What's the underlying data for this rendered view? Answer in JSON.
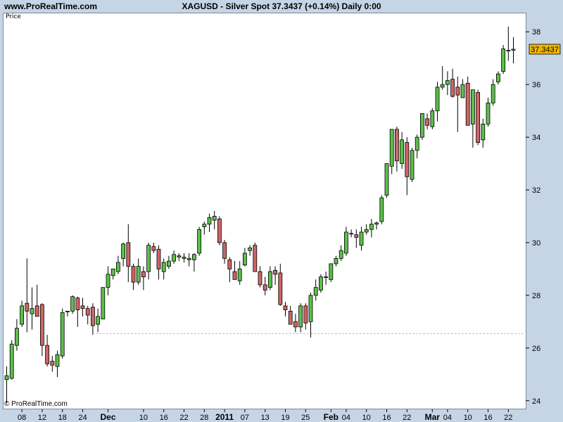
{
  "header": {
    "site": "www.ProRealTime.com",
    "title": "XAGUSD - Silver Spot    37.3437 (+0.14%)    Daily  0:00"
  },
  "panel": {
    "label": "Price"
  },
  "footer": {
    "copyright": "© ProRealTime.com"
  },
  "colors": {
    "up": "#5cbf4a",
    "down": "#cc6666",
    "background": "#c6d5e6",
    "last_price_box": "#f2b600"
  },
  "chart_data": {
    "type": "candlestick",
    "instrument": "XAGUSD - Silver Spot",
    "last_price": "37.3437",
    "change": "+0.14%",
    "timeframe": "Daily",
    "ylim": [
      23.7,
      38.7
    ],
    "yticks": [
      24,
      26,
      28,
      30,
      32,
      34,
      36,
      38
    ],
    "support_level": 26.55,
    "x_ticks": [
      {
        "label": "08",
        "i": 3,
        "bold": false
      },
      {
        "label": "12",
        "i": 7,
        "bold": false
      },
      {
        "label": "18",
        "i": 11,
        "bold": false
      },
      {
        "label": "24",
        "i": 15,
        "bold": false
      },
      {
        "label": "Dec",
        "i": 20,
        "bold": true
      },
      {
        "label": "10",
        "i": 27,
        "bold": false
      },
      {
        "label": "16",
        "i": 31,
        "bold": false
      },
      {
        "label": "22",
        "i": 35,
        "bold": false
      },
      {
        "label": "28",
        "i": 39,
        "bold": false
      },
      {
        "label": "2011",
        "i": 43,
        "bold": true
      },
      {
        "label": "07",
        "i": 47,
        "bold": false
      },
      {
        "label": "13",
        "i": 51,
        "bold": false
      },
      {
        "label": "19",
        "i": 55,
        "bold": false
      },
      {
        "label": "25",
        "i": 59,
        "bold": false
      },
      {
        "label": "Feb",
        "i": 64,
        "bold": true
      },
      {
        "label": "04",
        "i": 67,
        "bold": false
      },
      {
        "label": "10",
        "i": 71,
        "bold": false
      },
      {
        "label": "16",
        "i": 75,
        "bold": false
      },
      {
        "label": "22",
        "i": 79,
        "bold": false
      },
      {
        "label": "Mar",
        "i": 84,
        "bold": true
      },
      {
        "label": "04",
        "i": 87,
        "bold": false
      },
      {
        "label": "10",
        "i": 91,
        "bold": false
      },
      {
        "label": "16",
        "i": 95,
        "bold": false
      },
      {
        "label": "22",
        "i": 99,
        "bold": false
      }
    ],
    "candles": [
      [
        24.8,
        25.3,
        23.9,
        24.95
      ],
      [
        24.85,
        26.3,
        24.8,
        26.15
      ],
      [
        26.1,
        27.1,
        25.9,
        26.75
      ],
      [
        26.9,
        27.8,
        26.8,
        27.6
      ],
      [
        27.7,
        29.4,
        26.6,
        27.4
      ],
      [
        27.3,
        28.3,
        26.7,
        27.5
      ],
      [
        27.6,
        28.4,
        27.4,
        27.2
      ],
      [
        27.65,
        27.7,
        25.7,
        26.1
      ],
      [
        26.1,
        26.5,
        25.3,
        25.4
      ],
      [
        25.5,
        25.7,
        25.1,
        25.35
      ],
      [
        25.3,
        25.9,
        24.9,
        25.75
      ],
      [
        25.7,
        27.5,
        25.6,
        27.35
      ],
      [
        27.4,
        27.4,
        27.2,
        27.4
      ],
      [
        27.4,
        28.0,
        27.3,
        27.95
      ],
      [
        27.9,
        27.95,
        26.8,
        27.45
      ],
      [
        27.6,
        27.9,
        27.2,
        27.5
      ],
      [
        27.5,
        27.6,
        26.9,
        27.25
      ],
      [
        27.55,
        27.7,
        26.5,
        26.85
      ],
      [
        26.9,
        27.5,
        26.6,
        27.2
      ],
      [
        27.1,
        28.3,
        27.1,
        28.3
      ],
      [
        28.3,
        29.1,
        28.0,
        28.8
      ],
      [
        28.75,
        29.0,
        28.6,
        29.0
      ],
      [
        28.9,
        29.5,
        28.8,
        29.25
      ],
      [
        29.4,
        30.0,
        29.1,
        29.95
      ],
      [
        30.0,
        30.7,
        28.5,
        29.1
      ],
      [
        29.1,
        29.2,
        28.2,
        28.5
      ],
      [
        28.5,
        29.4,
        28.4,
        29.1
      ],
      [
        28.9,
        29.1,
        28.2,
        28.7
      ],
      [
        28.9,
        30.0,
        28.6,
        29.9
      ],
      [
        29.85,
        30.0,
        29.6,
        29.7
      ],
      [
        29.75,
        29.9,
        28.6,
        29.0
      ],
      [
        28.9,
        29.4,
        28.6,
        29.25
      ],
      [
        29.1,
        29.5,
        29.0,
        29.3
      ],
      [
        29.3,
        29.7,
        29.2,
        29.55
      ],
      [
        29.45,
        29.6,
        29.3,
        29.5
      ],
      [
        29.45,
        29.6,
        29.25,
        29.4
      ],
      [
        29.35,
        29.6,
        29.1,
        29.4
      ],
      [
        29.35,
        29.6,
        28.9,
        29.55
      ],
      [
        29.6,
        30.6,
        29.5,
        30.5
      ],
      [
        30.6,
        30.8,
        30.3,
        30.7
      ],
      [
        30.7,
        31.1,
        30.4,
        30.95
      ],
      [
        30.85,
        31.2,
        30.5,
        31.0
      ],
      [
        30.9,
        31.0,
        29.9,
        30.0
      ],
      [
        30.0,
        30.1,
        29.2,
        29.4
      ],
      [
        29.35,
        29.45,
        28.5,
        29.0
      ],
      [
        28.9,
        29.3,
        28.6,
        28.6
      ],
      [
        28.55,
        29.3,
        28.4,
        29.0
      ],
      [
        29.15,
        29.8,
        29.1,
        29.6
      ],
      [
        29.7,
        29.9,
        29.5,
        29.8
      ],
      [
        29.9,
        30.0,
        28.9,
        28.9
      ],
      [
        28.9,
        29.1,
        28.3,
        28.4
      ],
      [
        28.4,
        28.7,
        28.0,
        28.2
      ],
      [
        28.3,
        29.1,
        28.2,
        28.9
      ],
      [
        28.95,
        29.1,
        28.4,
        28.8
      ],
      [
        28.85,
        29.2,
        27.6,
        27.65
      ],
      [
        27.6,
        27.75,
        27.2,
        27.45
      ],
      [
        27.4,
        27.6,
        26.9,
        26.9
      ],
      [
        27.0,
        27.3,
        26.6,
        26.8
      ],
      [
        26.8,
        27.7,
        26.6,
        27.6
      ],
      [
        27.6,
        27.7,
        26.7,
        26.95
      ],
      [
        27.0,
        28.1,
        26.4,
        28.0
      ],
      [
        28.0,
        28.6,
        27.8,
        28.3
      ],
      [
        28.2,
        28.8,
        28.1,
        28.7
      ],
      [
        28.7,
        28.9,
        28.4,
        28.7
      ],
      [
        28.6,
        29.2,
        28.5,
        29.2
      ],
      [
        29.2,
        29.5,
        29.1,
        29.4
      ],
      [
        29.4,
        29.9,
        29.3,
        29.7
      ],
      [
        29.6,
        30.6,
        29.5,
        30.4
      ],
      [
        30.35,
        30.5,
        30.2,
        30.35
      ],
      [
        30.3,
        30.5,
        29.8,
        30.2
      ],
      [
        29.9,
        30.6,
        29.7,
        30.4
      ],
      [
        30.4,
        30.7,
        30.3,
        30.5
      ],
      [
        30.5,
        30.9,
        30.2,
        30.7
      ],
      [
        30.7,
        30.8,
        30.5,
        30.75
      ],
      [
        30.8,
        31.8,
        30.7,
        31.7
      ],
      [
        31.8,
        33.0,
        31.7,
        33.0
      ],
      [
        32.9,
        34.3,
        32.6,
        34.3
      ],
      [
        34.3,
        34.4,
        32.7,
        33.1
      ],
      [
        33.0,
        34.2,
        32.8,
        33.9
      ],
      [
        33.8,
        34.0,
        31.8,
        32.5
      ],
      [
        32.4,
        33.6,
        32.3,
        33.5
      ],
      [
        33.5,
        34.1,
        33.2,
        34.0
      ],
      [
        34.0,
        34.9,
        33.9,
        34.9
      ],
      [
        34.7,
        34.9,
        34.3,
        34.45
      ],
      [
        34.4,
        35.1,
        34.3,
        35.0
      ],
      [
        35.0,
        36.1,
        34.6,
        35.9
      ],
      [
        35.9,
        36.7,
        35.8,
        36.0
      ],
      [
        36.0,
        36.5,
        35.6,
        36.15
      ],
      [
        36.2,
        36.6,
        35.5,
        35.55
      ],
      [
        35.9,
        36.3,
        34.2,
        35.6
      ],
      [
        35.5,
        36.2,
        35.5,
        36.0
      ],
      [
        36.05,
        36.3,
        34.5,
        34.45
      ],
      [
        34.5,
        35.8,
        33.6,
        35.8
      ],
      [
        35.7,
        35.8,
        33.7,
        33.8
      ],
      [
        33.9,
        34.7,
        33.6,
        34.5
      ],
      [
        34.5,
        35.5,
        34.4,
        35.3
      ],
      [
        35.3,
        36.2,
        35.2,
        36.0
      ],
      [
        36.1,
        36.5,
        36.0,
        36.4
      ],
      [
        36.5,
        37.5,
        36.4,
        37.35
      ],
      [
        37.3,
        38.2,
        36.9,
        37.3
      ],
      [
        37.3,
        37.8,
        36.8,
        37.34
      ]
    ]
  }
}
